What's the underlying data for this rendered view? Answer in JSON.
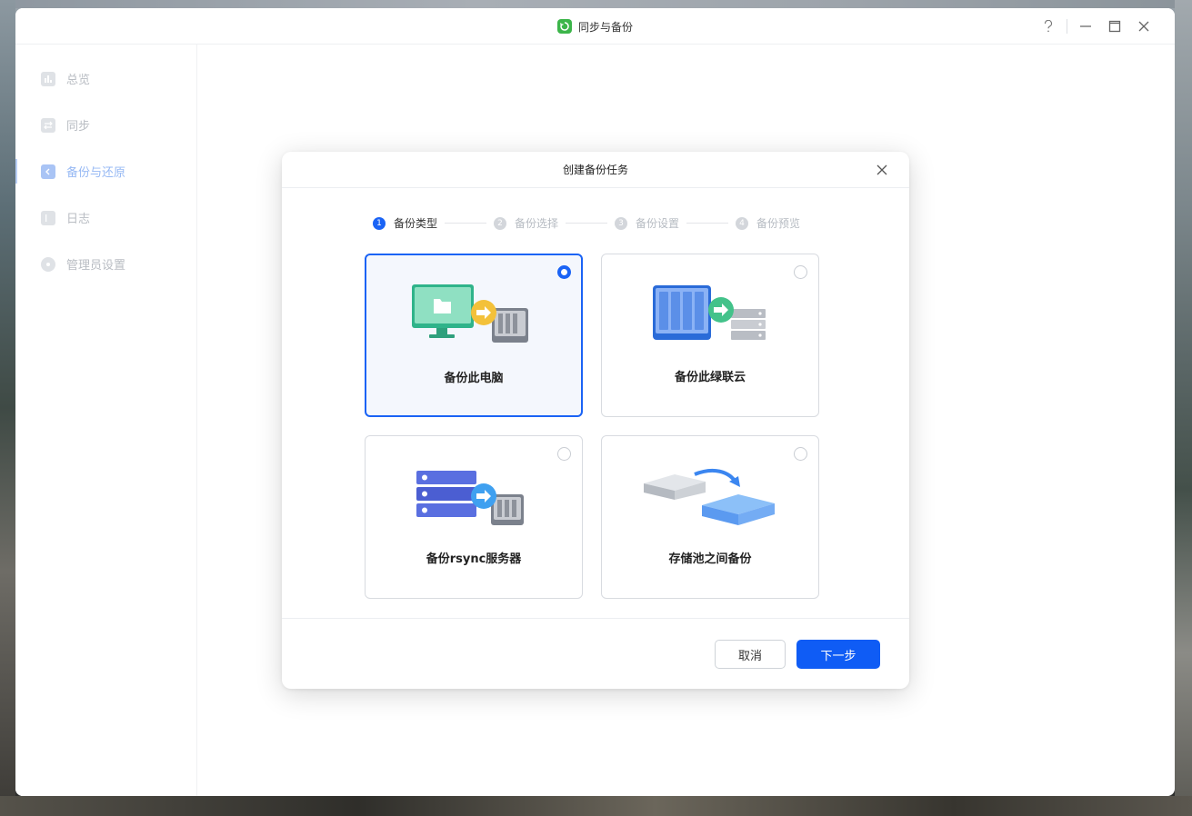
{
  "window": {
    "title": "同步与备份"
  },
  "sidebar": {
    "items": [
      {
        "label": "总览",
        "icon": "chart-icon",
        "active": false
      },
      {
        "label": "同步",
        "icon": "sync-icon",
        "active": false
      },
      {
        "label": "备份与还原",
        "icon": "backup-icon",
        "active": true
      },
      {
        "label": "日志",
        "icon": "log-icon",
        "active": false
      },
      {
        "label": "管理员设置",
        "icon": "gear-icon",
        "active": false
      }
    ]
  },
  "dialog": {
    "title": "创建备份任务",
    "steps": [
      {
        "num": "1",
        "label": "备份类型",
        "active": true
      },
      {
        "num": "2",
        "label": "备份选择",
        "active": false
      },
      {
        "num": "3",
        "label": "备份设置",
        "active": false
      },
      {
        "num": "4",
        "label": "备份预览",
        "active": false
      }
    ],
    "options": [
      {
        "label": "备份此电脑",
        "selected": true
      },
      {
        "label": "备份此绿联云",
        "selected": false
      },
      {
        "label": "备份rsync服务器",
        "selected": false
      },
      {
        "label": "存储池之间备份",
        "selected": false
      }
    ],
    "cancel_label": "取消",
    "next_label": "下一步"
  },
  "colors": {
    "accent": "#1a63f5",
    "app_icon": "#3cb54a"
  }
}
